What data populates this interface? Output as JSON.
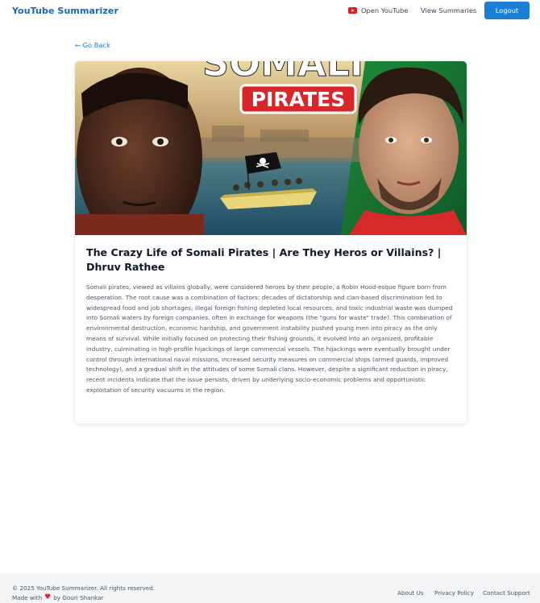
{
  "navbar": {
    "brand": "YouTube Summarizer",
    "open_youtube": "Open YouTube",
    "view_summaries": "View Summaries",
    "logout": "Logout"
  },
  "go_back": "← Go Back",
  "video": {
    "thumbnail_text": "PIRATES",
    "title": "The Crazy Life of Somali Pirates | Are They Heros or Villains? | Dhruv Rathee",
    "summary": "Somali pirates, viewed as villains globally, were considered heroes by their people, a Robin Hood-esque figure born from desperation. The root cause was a combination of factors: decades of dictatorship and clan-based discrimination led to widespread food and job shortages; illegal foreign fishing depleted local resources; and toxic industrial waste was dumped into Somali waters by foreign companies, often in exchange for weapons (the \"guns for waste\" trade). This combination of environmental destruction, economic hardship, and government instability pushed young men into piracy as the only means of survival. While initially focused on protecting their fishing grounds, it evolved into an organized, profitable industry, culminating in high-profile hijackings of large commercial vessels. The hijackings were eventually brought under control through international naval missions, increased security measures on commercial ships (armed guards, improved technology), and a gradual shift in the attitudes of some Somali clans. However, despite a significant reduction in piracy, recent incidents indicate that the issue persists, driven by underlying socio-economic problems and opportunistic exploitation of security vacuums in the region."
  },
  "footer": {
    "copyright": "© 2025 YouTube Summarizer. All rights reserved.",
    "made_with": "Made with",
    "by": "by Gouri Shankar",
    "links": [
      "About Us",
      "Privacy Policy",
      "Contact Support"
    ]
  },
  "colors": {
    "brand": "#1565c0",
    "primary": "#1a7fd4",
    "youtube_red": "#e11d1d",
    "heart": "#dc2626"
  },
  "icons": {
    "youtube": "youtube-icon",
    "heart": "heart-icon"
  }
}
